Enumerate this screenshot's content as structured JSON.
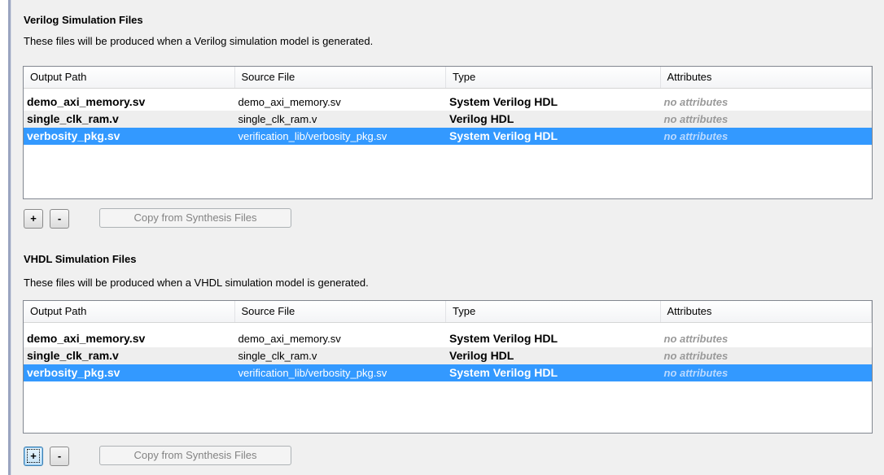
{
  "sections": [
    {
      "title": "Verilog Simulation Files",
      "description": "These files will be produced when a Verilog simulation model is generated.",
      "columns": [
        "Output Path",
        "Source File",
        "Type",
        "Attributes"
      ],
      "rows": [
        {
          "output_path": "demo_axi_memory.sv",
          "source_file": "demo_axi_memory.sv",
          "type": "System Verilog HDL",
          "attributes": "no attributes"
        },
        {
          "output_path": "single_clk_ram.v",
          "source_file": "single_clk_ram.v",
          "type": "Verilog HDL",
          "attributes": "no attributes"
        },
        {
          "output_path": "verbosity_pkg.sv",
          "source_file": "verification_lib/verbosity_pkg.sv",
          "type": "System Verilog HDL",
          "attributes": "no attributes"
        }
      ],
      "add_label": "+",
      "remove_label": "-",
      "copy_label": "Copy from Synthesis Files"
    },
    {
      "title": "VHDL Simulation Files",
      "description": "These files will be produced when a VHDL simulation model is generated.",
      "columns": [
        "Output Path",
        "Source File",
        "Type",
        "Attributes"
      ],
      "rows": [
        {
          "output_path": "demo_axi_memory.sv",
          "source_file": "demo_axi_memory.sv",
          "type": "System Verilog HDL",
          "attributes": "no attributes"
        },
        {
          "output_path": "single_clk_ram.v",
          "source_file": "single_clk_ram.v",
          "type": "Verilog HDL",
          "attributes": "no attributes"
        },
        {
          "output_path": "verbosity_pkg.sv",
          "source_file": "verification_lib/verbosity_pkg.sv",
          "type": "System Verilog HDL",
          "attributes": "no attributes"
        }
      ],
      "add_label": "+",
      "remove_label": "-",
      "copy_label": "Copy from Synthesis Files"
    }
  ],
  "colors": {
    "selection": "#3399ff",
    "stripe": "#eeeeee",
    "attribute_text": "#9a9a9a"
  }
}
